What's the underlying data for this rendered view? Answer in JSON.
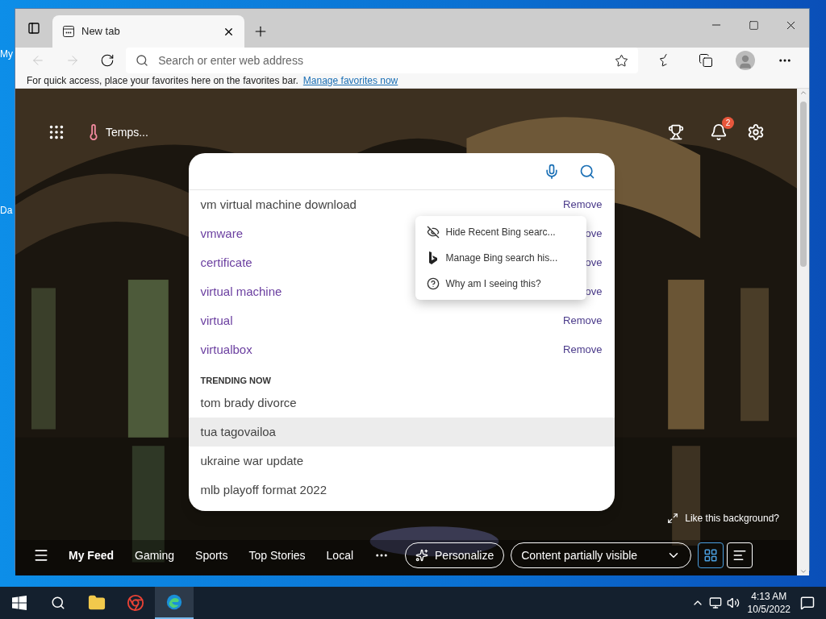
{
  "desktop": {
    "labels": [
      "My",
      "Da"
    ]
  },
  "browser": {
    "tabs": [
      {
        "title": "New tab",
        "selected": true
      }
    ],
    "address_bar": {
      "placeholder": "Search or enter web address"
    },
    "favorites_bar": {
      "message": "For quick access, place your favorites here on the favorites bar.",
      "link": "Manage favorites now"
    }
  },
  "new_tab": {
    "weather": "Temps...",
    "notification_count": "2",
    "search": {
      "history": [
        {
          "text": "vm virtual machine download",
          "remove": "Remove"
        },
        {
          "text": "vmware",
          "remove": "ove"
        },
        {
          "text": "certificate",
          "remove": "ove"
        },
        {
          "text": "virtual machine",
          "remove": "ove"
        },
        {
          "text": "virtual",
          "remove": "Remove"
        },
        {
          "text": "virtualbox",
          "remove": "Remove"
        }
      ],
      "trending_header": "TRENDING NOW",
      "trending": [
        {
          "text": "tom brady divorce",
          "selected": false
        },
        {
          "text": "tua tagovailoa",
          "selected": true
        },
        {
          "text": "ukraine war update",
          "selected": false
        },
        {
          "text": "mlb playoff format 2022",
          "selected": false
        }
      ]
    },
    "context_menu": [
      {
        "kind": "hide",
        "label": "Hide Recent Bing searc..."
      },
      {
        "kind": "bing",
        "label": "Manage Bing search his..."
      },
      {
        "kind": "help",
        "label": "Why am I seeing this?"
      }
    ],
    "background_prompt": "Like this background?",
    "feed_nav": [
      {
        "label": "My Feed",
        "selected": true
      },
      {
        "label": "Gaming",
        "selected": false
      },
      {
        "label": "Sports",
        "selected": false
      },
      {
        "label": "Top Stories",
        "selected": false
      },
      {
        "label": "Local",
        "selected": false
      }
    ],
    "personalize": "Personalize",
    "content_visibility": "Content partially visible",
    "views": [
      {
        "kind": "grid",
        "selected": true
      },
      {
        "kind": "list",
        "selected": false
      }
    ]
  },
  "taskbar": {
    "apps": [
      {
        "kind": "explorer",
        "selected": false
      },
      {
        "kind": "chrome",
        "selected": false
      },
      {
        "kind": "edge",
        "selected": true
      }
    ],
    "time": "4:13 AM",
    "date": "10/5/2022"
  }
}
